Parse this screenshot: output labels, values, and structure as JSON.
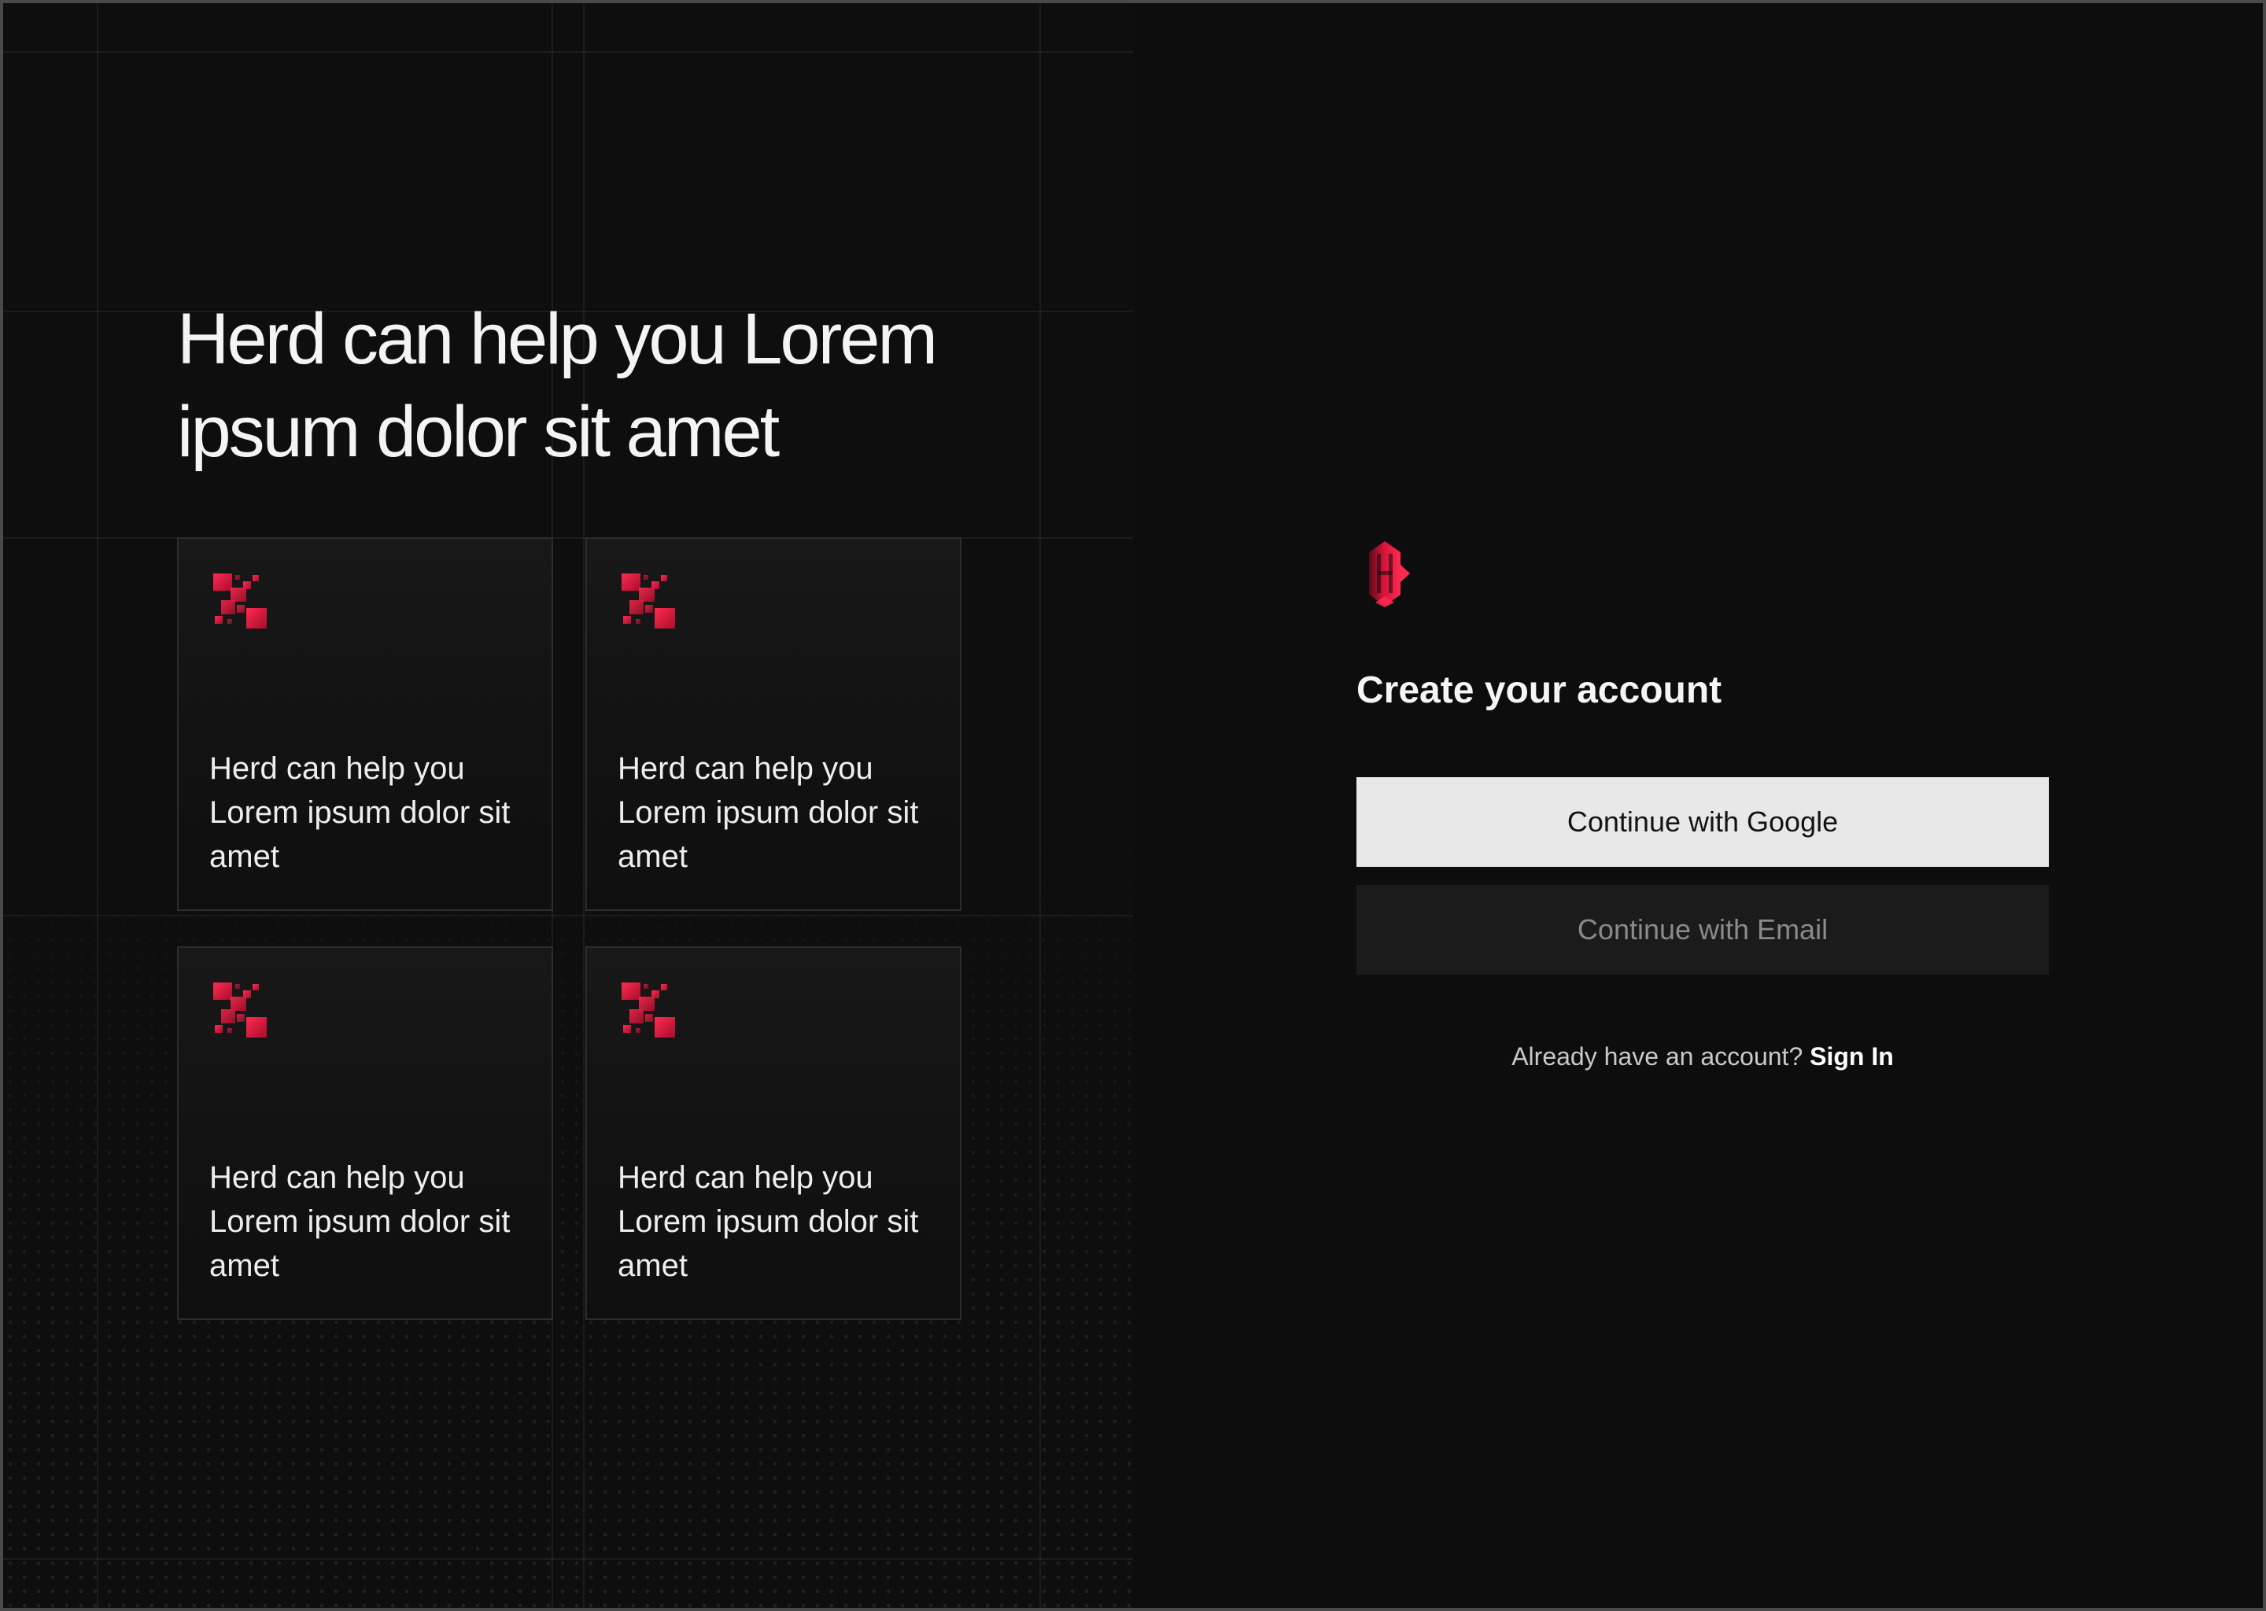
{
  "left_panel": {
    "headline_line1": "Herd can help you Lorem",
    "headline_line2": "ipsum dolor sit amet",
    "cards": [
      {
        "icon": "red-pixel-cluster-icon",
        "text": "Herd can help you Lorem ipsum dolor sit amet"
      },
      {
        "icon": "red-pixel-cluster-icon",
        "text": "Herd can help you Lorem ipsum dolor sit amet"
      },
      {
        "icon": "red-pixel-cluster-icon",
        "text": "Herd can help you Lorem ipsum dolor sit amet"
      },
      {
        "icon": "red-pixel-cluster-icon",
        "text": "Herd can help you Lorem ipsum dolor sit amet"
      }
    ]
  },
  "auth": {
    "logo_icon": "herd-logo-icon",
    "title": "Create your account",
    "google_button_label": "Continue with Google",
    "email_button_label": "Continue with Email",
    "signin_prompt": "Already have an account?",
    "signin_link_label": "Sign In"
  },
  "colors": {
    "background": "#0d0d0d",
    "accent_red": "#e0163e",
    "primary_button_bg": "#e8e8e8",
    "secondary_button_bg": "#1b1b1b"
  }
}
